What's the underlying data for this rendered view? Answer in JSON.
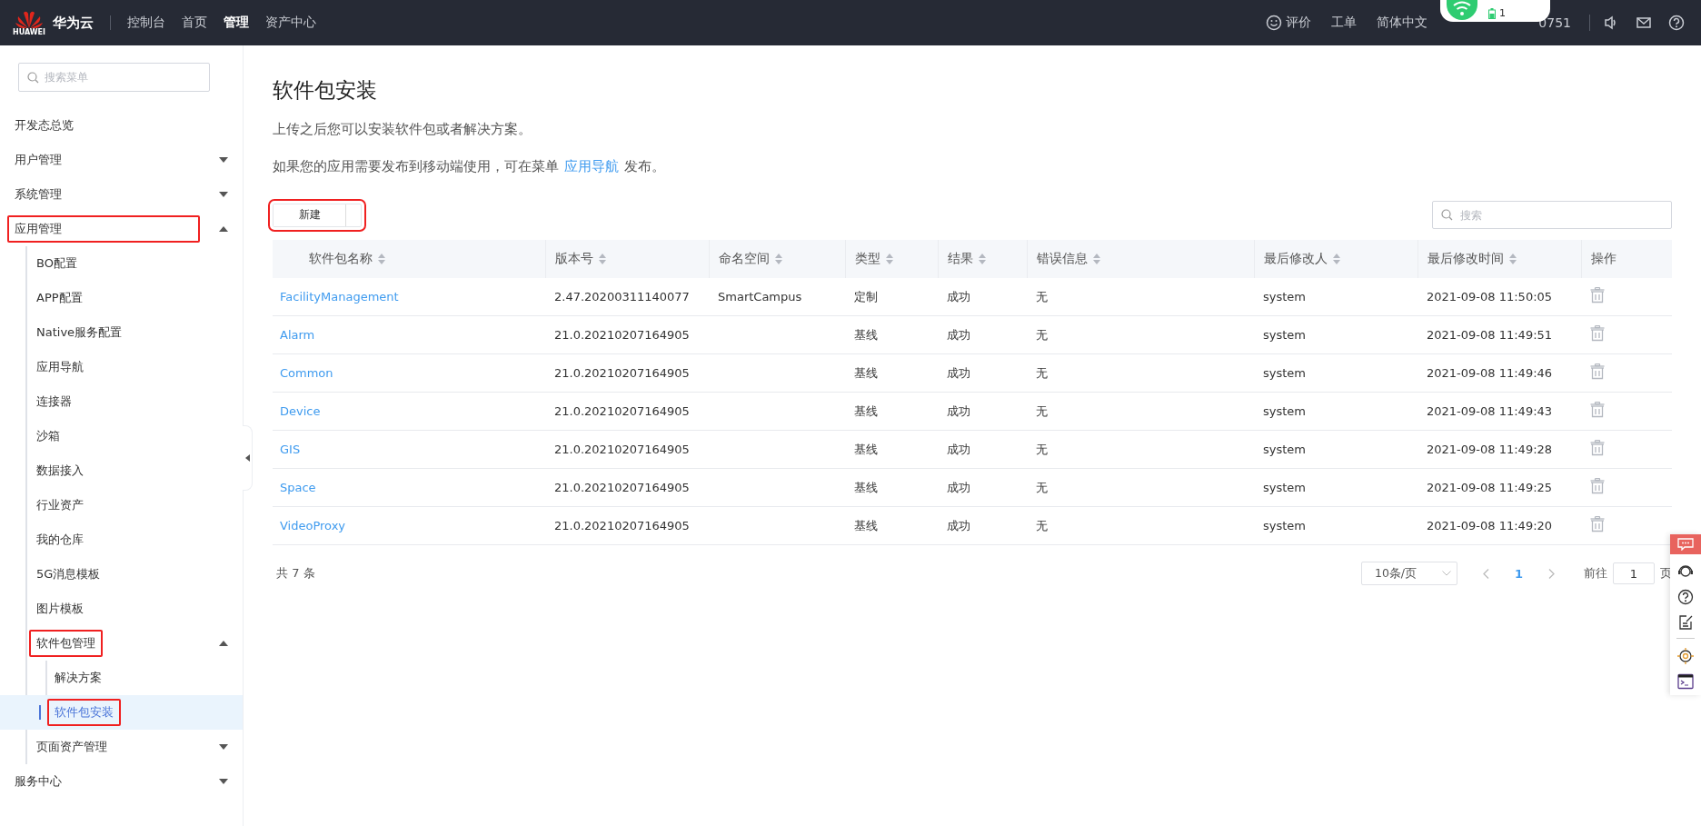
{
  "topbar": {
    "logo_text": "HUAWEI",
    "brand": "华为云",
    "nav": [
      {
        "label": "控制台",
        "selected": false
      },
      {
        "label": "首页",
        "selected": false
      },
      {
        "label": "管理",
        "selected": true
      },
      {
        "label": "资产中心",
        "selected": false
      }
    ],
    "links": [
      "评价",
      "工单",
      "简体中文"
    ],
    "account": "0751",
    "popup": {
      "battery": "1"
    }
  },
  "sidebar": {
    "search": {
      "placeholder": "搜索菜单"
    },
    "items": [
      {
        "label": "开发态总览",
        "selected": false,
        "highlighted": false
      },
      {
        "label": "用户管理",
        "expanded": false,
        "selected": false,
        "highlighted": false
      },
      {
        "label": "系统管理",
        "expanded": false,
        "selected": false,
        "highlighted": false
      },
      {
        "label": "应用管理",
        "expanded": true,
        "selected": false,
        "highlighted": true,
        "children": [
          {
            "label": "BO配置",
            "selected": false,
            "highlighted": false
          },
          {
            "label": "APP配置",
            "selected": false,
            "highlighted": false
          },
          {
            "label": "Native服务配置",
            "selected": false,
            "highlighted": false
          },
          {
            "label": "应用导航",
            "selected": false,
            "highlighted": false
          },
          {
            "label": "连接器",
            "selected": false,
            "highlighted": false
          },
          {
            "label": "沙箱",
            "selected": false,
            "highlighted": false
          },
          {
            "label": "数据接入",
            "selected": false,
            "highlighted": false
          },
          {
            "label": "行业资产",
            "selected": false,
            "highlighted": false
          },
          {
            "label": "我的仓库",
            "selected": false,
            "highlighted": false
          },
          {
            "label": "5G消息模板",
            "selected": false,
            "highlighted": false
          },
          {
            "label": "图片模板",
            "selected": false,
            "highlighted": false
          },
          {
            "label": "软件包管理",
            "expanded": true,
            "selected": false,
            "highlighted": true,
            "children": [
              {
                "label": "解决方案",
                "selected": false,
                "highlighted": false
              },
              {
                "label": "软件包安装",
                "selected": true,
                "highlighted": true
              }
            ]
          },
          {
            "label": "页面资产管理",
            "expanded": false,
            "selected": false,
            "highlighted": false
          }
        ]
      },
      {
        "label": "服务中心",
        "expanded": false,
        "selected": false,
        "highlighted": false
      }
    ]
  },
  "page": {
    "title": "软件包安装",
    "description": "上传之后您可以安装软件包或者解决方案。",
    "hint": {
      "before": "如果您的应用需要发布到移动端使用，可在菜单",
      "link": "应用导航",
      "after": "发布。"
    },
    "new_button": {
      "label": "新建",
      "highlighted": true
    },
    "search": {
      "placeholder": "搜索"
    },
    "table": {
      "columns": [
        {
          "label": "软件包名称",
          "sortable": true
        },
        {
          "label": "版本号",
          "sortable": true
        },
        {
          "label": "命名空间",
          "sortable": true
        },
        {
          "label": "类型",
          "sortable": true
        },
        {
          "label": "结果",
          "sortable": true
        },
        {
          "label": "错误信息",
          "sortable": true
        },
        {
          "label": "最后修改人",
          "sortable": true
        },
        {
          "label": "最后修改时间",
          "sortable": true
        },
        {
          "label": "操作",
          "sortable": false
        }
      ],
      "rows": [
        {
          "name": "FacilityManagement",
          "version": "2.47.20200311140077",
          "namespace": "SmartCampus",
          "type": "定制",
          "result": "成功",
          "error": "无",
          "modifier": "system",
          "time": "2021-09-08 11:50:05"
        },
        {
          "name": "Alarm",
          "version": "21.0.20210207164905",
          "type": "基线",
          "result": "成功",
          "error": "无",
          "modifier": "system",
          "time": "2021-09-08 11:49:51"
        },
        {
          "name": "Common",
          "version": "21.0.20210207164905",
          "type": "基线",
          "result": "成功",
          "error": "无",
          "modifier": "system",
          "time": "2021-09-08 11:49:46"
        },
        {
          "name": "Device",
          "version": "21.0.20210207164905",
          "type": "基线",
          "result": "成功",
          "error": "无",
          "modifier": "system",
          "time": "2021-09-08 11:49:43"
        },
        {
          "name": "GIS",
          "version": "21.0.20210207164905",
          "type": "基线",
          "result": "成功",
          "error": "无",
          "modifier": "system",
          "time": "2021-09-08 11:49:28"
        },
        {
          "name": "Space",
          "version": "21.0.20210207164905",
          "type": "基线",
          "result": "成功",
          "error": "无",
          "modifier": "system",
          "time": "2021-09-08 11:49:25"
        },
        {
          "name": "VideoProxy",
          "version": "21.0.20210207164905",
          "type": "基线",
          "result": "成功",
          "error": "无",
          "modifier": "system",
          "time": "2021-09-08 11:49:20"
        }
      ]
    },
    "pagination": {
      "total": "共 7 条",
      "page_size": "10条/页",
      "pages": [
        {
          "label": "1",
          "selected": true
        }
      ],
      "goto_label": "前往",
      "goto_value": "1",
      "page_unit": "页"
    }
  }
}
